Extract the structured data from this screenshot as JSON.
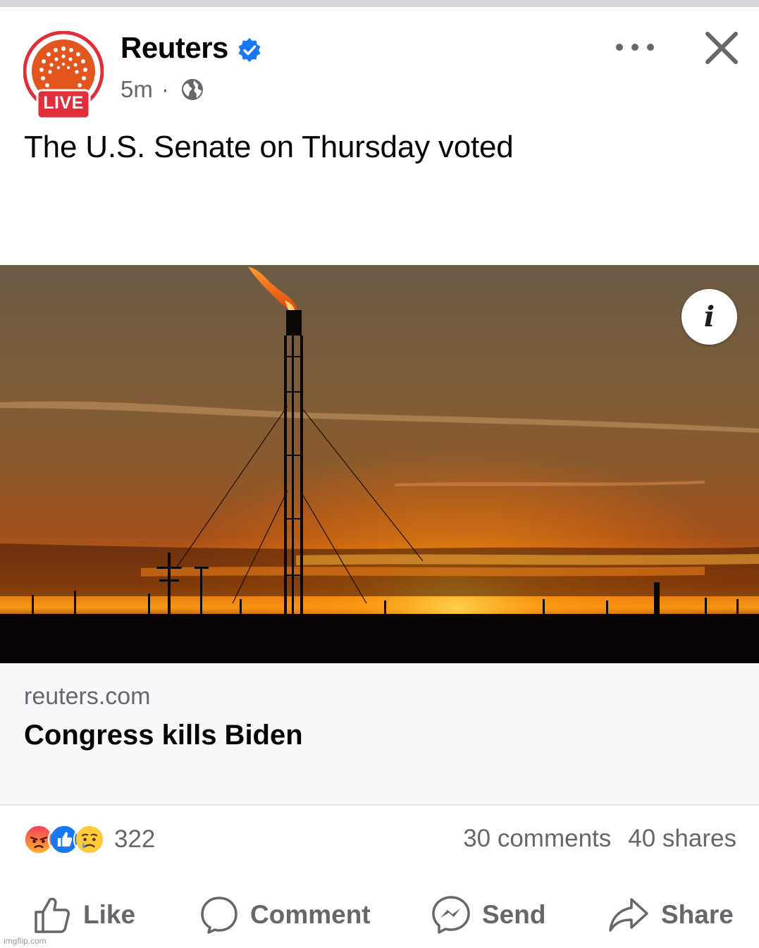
{
  "post": {
    "page_name": "Reuters",
    "live_badge": "LIVE",
    "time": "5m",
    "separator": "·",
    "audience_icon": "globe-icon",
    "verified_icon": "verified-badge-icon",
    "text": "The U.S. Senate on Thursday voted"
  },
  "header_actions": {
    "more_icon": "more-options-icon",
    "close_icon": "close-icon"
  },
  "media": {
    "info_label": "i"
  },
  "link_preview": {
    "domain": "reuters.com",
    "title": "Congress kills Biden"
  },
  "engagement": {
    "reactions": [
      "angry",
      "like",
      "sad"
    ],
    "reaction_count": "322",
    "comments": "30 comments",
    "shares": "40 shares"
  },
  "actions": {
    "like": "Like",
    "comment": "Comment",
    "send": "Send",
    "share": "Share"
  },
  "watermark": "imgflip.com",
  "colors": {
    "reuters_orange": "#e2551d",
    "live_red": "#e02f3b",
    "verified_blue": "#1877f2",
    "secondary_text": "#65676b"
  }
}
